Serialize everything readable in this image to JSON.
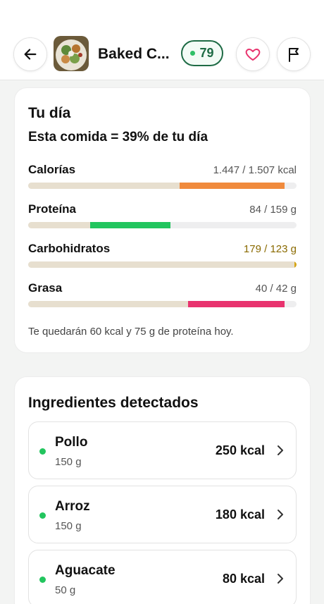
{
  "header": {
    "title": "Baked C...",
    "score": "79",
    "icons": {
      "back": "back-arrow-icon",
      "favorite": "heart-icon",
      "report": "flag-icon"
    },
    "accent": "#1e6b45"
  },
  "day": {
    "title": "Tu día",
    "summary": "Esta comida = 39% de tu día",
    "macros": [
      {
        "label": "Calorías",
        "value": "1.447 / 1.507 kcal",
        "color": "#f08a3c",
        "consumed_before_fraction": 0.565,
        "meal_fraction": 0.39,
        "over": false
      },
      {
        "label": "Proteína",
        "value": "84 / 159 g",
        "color": "#22c55e",
        "consumed_before_fraction": 0.23,
        "meal_fraction": 0.3,
        "over": false
      },
      {
        "label": "Carbohidratos",
        "value": "179 / 123 g",
        "color": "#d6a515",
        "consumed_before_fraction": 1.0,
        "meal_fraction": 0.0,
        "over": true
      },
      {
        "label": "Grasa",
        "value": "40 / 42 g",
        "color": "#e8336e",
        "consumed_before_fraction": 0.595,
        "meal_fraction": 0.36,
        "over": false
      }
    ],
    "footnote": "Te quedarán 60 kcal y 75 g de proteína hoy."
  },
  "ingredients": {
    "title": "Ingredientes detectados",
    "items": [
      {
        "name": "Pollo",
        "qty": "150 g",
        "kcal": "250 kcal"
      },
      {
        "name": "Arroz",
        "qty": "150 g",
        "kcal": "180 kcal"
      },
      {
        "name": "Aguacate",
        "qty": "50 g",
        "kcal": "80 kcal"
      }
    ]
  }
}
